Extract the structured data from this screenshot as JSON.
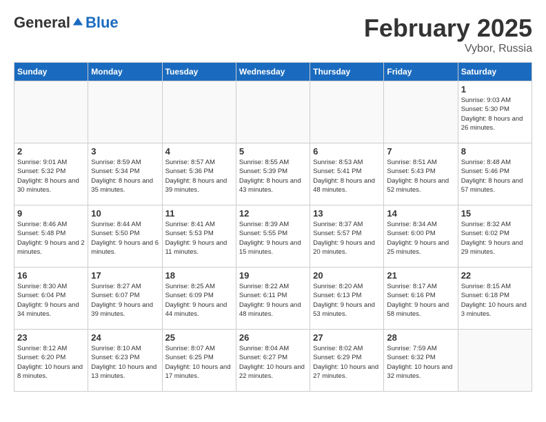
{
  "header": {
    "logo_general": "General",
    "logo_blue": "Blue",
    "month_title": "February 2025",
    "location": "Vybor, Russia"
  },
  "weekdays": [
    "Sunday",
    "Monday",
    "Tuesday",
    "Wednesday",
    "Thursday",
    "Friday",
    "Saturday"
  ],
  "weeks": [
    [
      {
        "day": "",
        "info": ""
      },
      {
        "day": "",
        "info": ""
      },
      {
        "day": "",
        "info": ""
      },
      {
        "day": "",
        "info": ""
      },
      {
        "day": "",
        "info": ""
      },
      {
        "day": "",
        "info": ""
      },
      {
        "day": "1",
        "info": "Sunrise: 9:03 AM\nSunset: 5:30 PM\nDaylight: 8 hours and 26 minutes."
      }
    ],
    [
      {
        "day": "2",
        "info": "Sunrise: 9:01 AM\nSunset: 5:32 PM\nDaylight: 8 hours and 30 minutes."
      },
      {
        "day": "3",
        "info": "Sunrise: 8:59 AM\nSunset: 5:34 PM\nDaylight: 8 hours and 35 minutes."
      },
      {
        "day": "4",
        "info": "Sunrise: 8:57 AM\nSunset: 5:36 PM\nDaylight: 8 hours and 39 minutes."
      },
      {
        "day": "5",
        "info": "Sunrise: 8:55 AM\nSunset: 5:39 PM\nDaylight: 8 hours and 43 minutes."
      },
      {
        "day": "6",
        "info": "Sunrise: 8:53 AM\nSunset: 5:41 PM\nDaylight: 8 hours and 48 minutes."
      },
      {
        "day": "7",
        "info": "Sunrise: 8:51 AM\nSunset: 5:43 PM\nDaylight: 8 hours and 52 minutes."
      },
      {
        "day": "8",
        "info": "Sunrise: 8:48 AM\nSunset: 5:46 PM\nDaylight: 8 hours and 57 minutes."
      }
    ],
    [
      {
        "day": "9",
        "info": "Sunrise: 8:46 AM\nSunset: 5:48 PM\nDaylight: 9 hours and 2 minutes."
      },
      {
        "day": "10",
        "info": "Sunrise: 8:44 AM\nSunset: 5:50 PM\nDaylight: 9 hours and 6 minutes."
      },
      {
        "day": "11",
        "info": "Sunrise: 8:41 AM\nSunset: 5:53 PM\nDaylight: 9 hours and 11 minutes."
      },
      {
        "day": "12",
        "info": "Sunrise: 8:39 AM\nSunset: 5:55 PM\nDaylight: 9 hours and 15 minutes."
      },
      {
        "day": "13",
        "info": "Sunrise: 8:37 AM\nSunset: 5:57 PM\nDaylight: 9 hours and 20 minutes."
      },
      {
        "day": "14",
        "info": "Sunrise: 8:34 AM\nSunset: 6:00 PM\nDaylight: 9 hours and 25 minutes."
      },
      {
        "day": "15",
        "info": "Sunrise: 8:32 AM\nSunset: 6:02 PM\nDaylight: 9 hours and 29 minutes."
      }
    ],
    [
      {
        "day": "16",
        "info": "Sunrise: 8:30 AM\nSunset: 6:04 PM\nDaylight: 9 hours and 34 minutes."
      },
      {
        "day": "17",
        "info": "Sunrise: 8:27 AM\nSunset: 6:07 PM\nDaylight: 9 hours and 39 minutes."
      },
      {
        "day": "18",
        "info": "Sunrise: 8:25 AM\nSunset: 6:09 PM\nDaylight: 9 hours and 44 minutes."
      },
      {
        "day": "19",
        "info": "Sunrise: 8:22 AM\nSunset: 6:11 PM\nDaylight: 9 hours and 48 minutes."
      },
      {
        "day": "20",
        "info": "Sunrise: 8:20 AM\nSunset: 6:13 PM\nDaylight: 9 hours and 53 minutes."
      },
      {
        "day": "21",
        "info": "Sunrise: 8:17 AM\nSunset: 6:16 PM\nDaylight: 9 hours and 58 minutes."
      },
      {
        "day": "22",
        "info": "Sunrise: 8:15 AM\nSunset: 6:18 PM\nDaylight: 10 hours and 3 minutes."
      }
    ],
    [
      {
        "day": "23",
        "info": "Sunrise: 8:12 AM\nSunset: 6:20 PM\nDaylight: 10 hours and 8 minutes."
      },
      {
        "day": "24",
        "info": "Sunrise: 8:10 AM\nSunset: 6:23 PM\nDaylight: 10 hours and 13 minutes."
      },
      {
        "day": "25",
        "info": "Sunrise: 8:07 AM\nSunset: 6:25 PM\nDaylight: 10 hours and 17 minutes."
      },
      {
        "day": "26",
        "info": "Sunrise: 8:04 AM\nSunset: 6:27 PM\nDaylight: 10 hours and 22 minutes."
      },
      {
        "day": "27",
        "info": "Sunrise: 8:02 AM\nSunset: 6:29 PM\nDaylight: 10 hours and 27 minutes."
      },
      {
        "day": "28",
        "info": "Sunrise: 7:59 AM\nSunset: 6:32 PM\nDaylight: 10 hours and 32 minutes."
      },
      {
        "day": "",
        "info": ""
      }
    ]
  ]
}
